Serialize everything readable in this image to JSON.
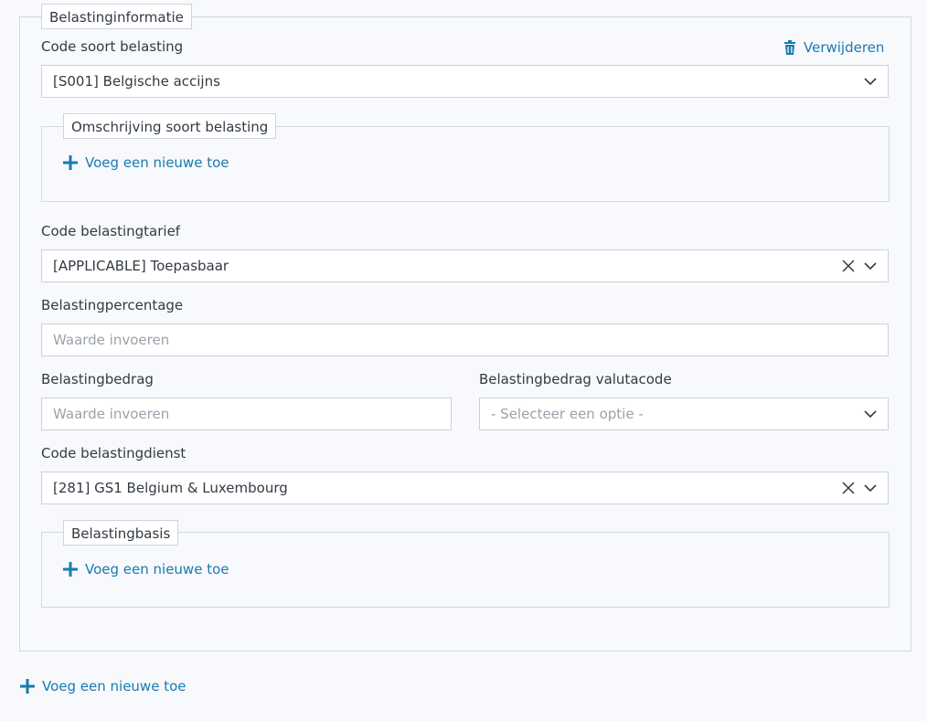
{
  "tax_info": {
    "legend": "Belastinginformatie",
    "remove_label": "Verwijderen",
    "tax_type_code": {
      "label": "Code soort belasting",
      "value": "[S001] Belgische accijns"
    },
    "tax_type_description": {
      "legend": "Omschrijving soort belasting",
      "add_label": "Voeg een nieuwe toe"
    },
    "tax_rate_code": {
      "label": "Code belastingtarief",
      "value": "[APPLICABLE] Toepasbaar"
    },
    "tax_percentage": {
      "label": "Belastingpercentage",
      "placeholder": "Waarde invoeren"
    },
    "tax_amount": {
      "label": "Belastingbedrag",
      "placeholder": "Waarde invoeren"
    },
    "tax_currency": {
      "label": "Belastingbedrag valutacode",
      "placeholder": "- Selecteer een optie -"
    },
    "tax_agency_code": {
      "label": "Code belastingdienst",
      "value": "[281] GS1 Belgium & Luxembourg"
    },
    "tax_basis": {
      "legend": "Belastingbasis",
      "add_label": "Voeg een nieuwe toe"
    }
  },
  "footer": {
    "add_label": "Voeg een nieuwe toe"
  },
  "colors": {
    "accent": "#1a7bb0",
    "border": "#cdd9e6",
    "background": "#f7f9fc"
  }
}
